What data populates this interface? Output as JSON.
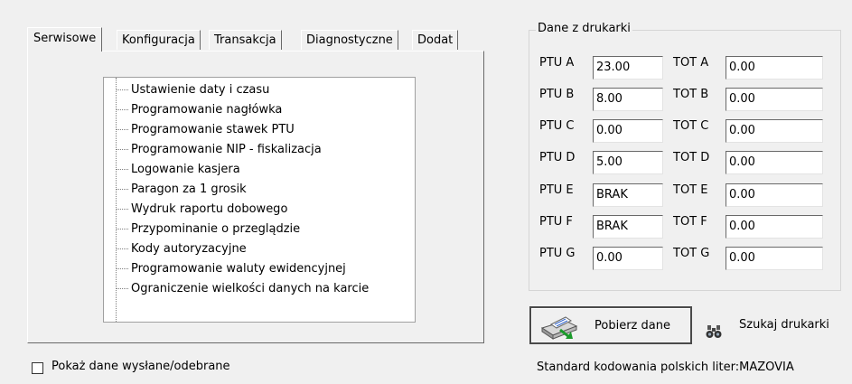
{
  "tabs": [
    {
      "label": "Serwisowe",
      "active": true
    },
    {
      "label": "Konfiguracja"
    },
    {
      "label": "Transakcja"
    },
    {
      "label": "Diagnostyczne"
    },
    {
      "label": "Dodat"
    }
  ],
  "service_list": [
    "Ustawienie daty i czasu",
    "Programowanie nagłówka",
    "Programowanie stawek PTU",
    "Programowanie NIP - fiskalizacja",
    "Logowanie kasjera",
    "Paragon za 1 grosik",
    "Wydruk raportu dobowego",
    "Przypominanie o przeglądzie",
    "Kody autoryzacyjne",
    "Programowanie waluty ewidencyjnej",
    "Ograniczenie wielkości danych na karcie"
  ],
  "show_data_checkbox": {
    "label": "Pokaż dane wysłane/odebrane",
    "checked": false
  },
  "printer_data": {
    "title": "Dane z drukarki",
    "rows": [
      {
        "ptu_label": "PTU A",
        "ptu_value": "23.00",
        "tot_label": "TOT A",
        "tot_value": "0.00"
      },
      {
        "ptu_label": "PTU B",
        "ptu_value": "8.00",
        "tot_label": "TOT B",
        "tot_value": "0.00"
      },
      {
        "ptu_label": "PTU C",
        "ptu_value": "0.00",
        "tot_label": "TOT C",
        "tot_value": "0.00"
      },
      {
        "ptu_label": "PTU D",
        "ptu_value": "5.00",
        "tot_label": "TOT D",
        "tot_value": "0.00"
      },
      {
        "ptu_label": "PTU E",
        "ptu_value": "BRAK",
        "tot_label": "TOT E",
        "tot_value": "0.00"
      },
      {
        "ptu_label": "PTU F",
        "ptu_value": "BRAK",
        "tot_label": "TOT F",
        "tot_value": "0.00"
      },
      {
        "ptu_label": "PTU G",
        "ptu_value": "0.00",
        "tot_label": "TOT G",
        "tot_value": "0.00"
      }
    ]
  },
  "buttons": {
    "fetch_data": {
      "label": "Pobierz dane",
      "icon": "printer-icon"
    },
    "find_printer": {
      "label": "Szukaj drukarki",
      "icon": "binoculars-icon"
    }
  },
  "status_text": "Standard kodowania polskich liter:MAZOVIA"
}
